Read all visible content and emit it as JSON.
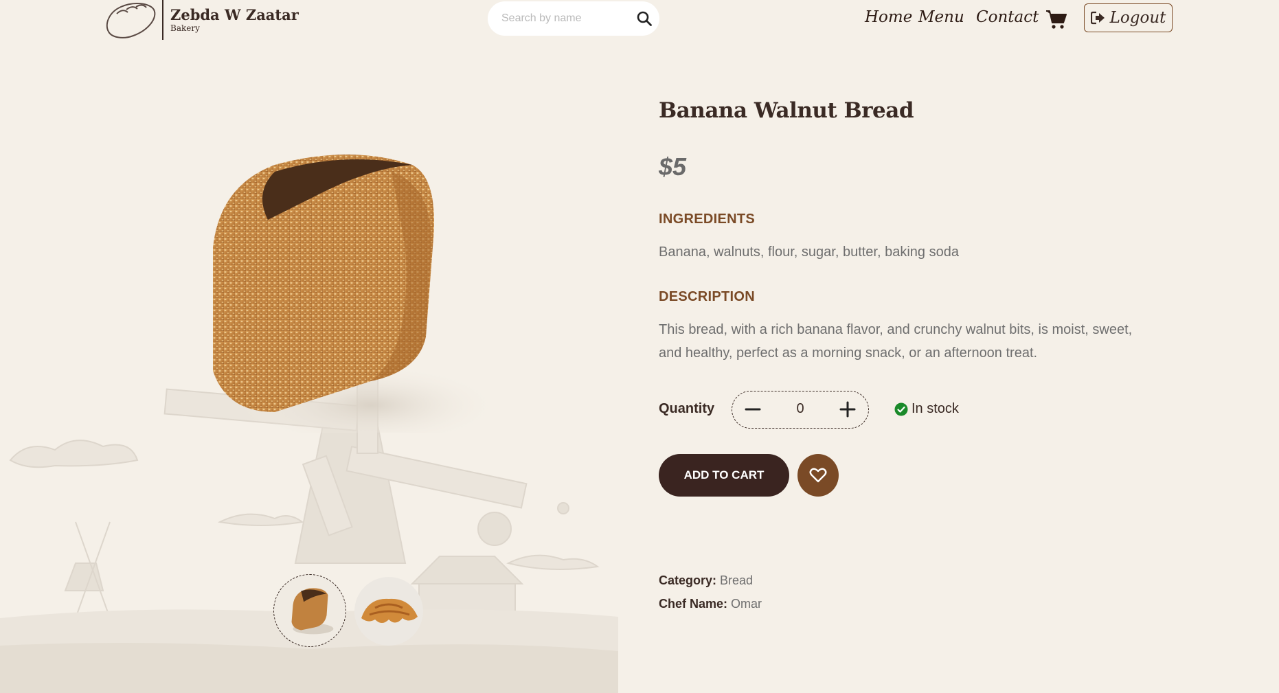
{
  "brand": {
    "name": "Zebda W Zaatar",
    "tagline": "Bakery"
  },
  "search": {
    "placeholder": "Search by name"
  },
  "nav": {
    "home": "Home",
    "menu": "Menu",
    "contact": "Contact",
    "logout": "Logout"
  },
  "product": {
    "title": "Banana Walnut Bread",
    "price": "$5",
    "ingredients_heading": "INGREDIENTS",
    "ingredients": "Banana, walnuts, flour, sugar, butter, baking soda",
    "description_heading": "DESCRIPTION",
    "description_line1": "This bread, with a rich banana flavor, and crunchy walnut bits, is moist, sweet,",
    "description_line2": "and healthy, perfect as a morning snack, or an afternoon treat.",
    "quantity_label": "Quantity",
    "quantity": "0",
    "stock_status": "In stock",
    "add_to_cart": "ADD TO CART",
    "category_label": "Category:",
    "category": "Bread",
    "chef_label": "Chef Name:",
    "chef": "Omar"
  },
  "colors": {
    "background": "#f5f0e8",
    "primary_dark": "#3a2420",
    "accent_brown": "#7a4a26",
    "stock_green": "#1a8a2a"
  },
  "icons": [
    "bread-logo-icon",
    "search-icon",
    "cart-icon",
    "logout-icon",
    "minus-icon",
    "plus-icon",
    "check-circle-icon",
    "heart-icon"
  ]
}
